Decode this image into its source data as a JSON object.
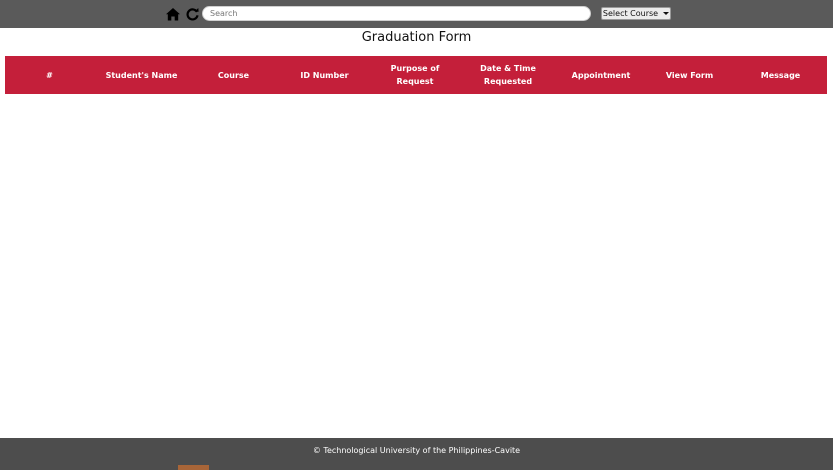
{
  "topbar": {
    "search_placeholder": "Search",
    "select_course_label": "Select Course",
    "home_icon": "home-icon",
    "refresh_icon": "refresh-icon"
  },
  "page": {
    "title": "Graduation Form"
  },
  "table": {
    "columns": [
      "#",
      "Student's Name",
      "Course",
      "ID Number",
      "Purpose of Request",
      "Date & Time Requested",
      "Appointment",
      "View Form",
      "Message"
    ]
  },
  "footer": {
    "text": "© Technological University of the Philippines-Cavite"
  },
  "colors": {
    "topbar_bg": "#5a5a5a",
    "header_red": "#c41f3a",
    "footer_bg": "#4d4d4d"
  }
}
